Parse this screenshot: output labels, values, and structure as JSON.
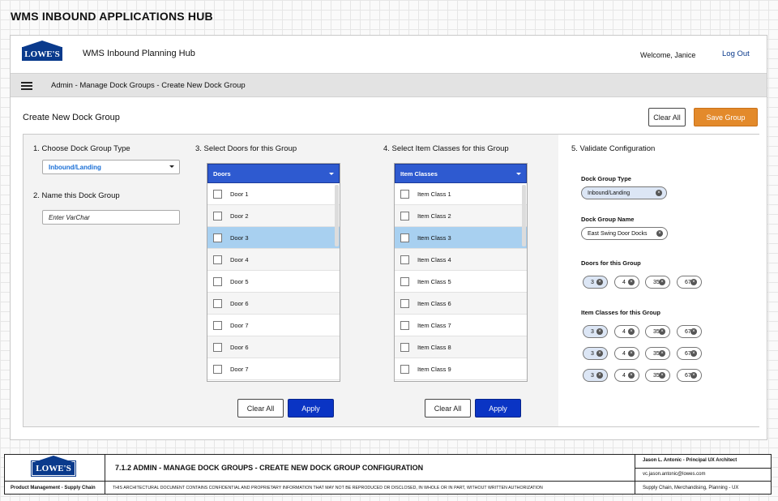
{
  "doc_title": "WMS INBOUND APPLICATIONS HUB",
  "header": {
    "logo_text": "LOWE'S",
    "app_name": "WMS Inbound Planning Hub",
    "welcome": "Welcome, Janice",
    "logout": "Log Out"
  },
  "breadcrumb": "Admin - Manage Dock Groups - Create New Dock Group",
  "page": {
    "title": "Create New Dock Group",
    "clear_all": "Clear All",
    "save_group": "Save Group"
  },
  "steps": {
    "s1": "1. Choose Dock Group Type",
    "s2": "2. Name this Dock Group",
    "s3": "3. Select Doors for this Group",
    "s4": "4. Select Item Classes for this Group",
    "s5": "5. Validate Configuration"
  },
  "dock_type_select": {
    "value": "Inbound/Landing"
  },
  "name_input": {
    "placeholder": "Enter VarChar"
  },
  "doors": {
    "header": "Doors",
    "items": [
      "Door 1",
      "Door 2",
      "Door 3",
      "Door 4",
      "Door 5",
      "Door 6",
      "Door 7",
      "Door 6",
      "Door 7"
    ],
    "selected_index": 2,
    "clear_label": "Clear All",
    "apply_label": "Apply"
  },
  "item_classes": {
    "header": "Item Classes",
    "items": [
      "Item Class 1",
      "Item Class 2",
      "Item Class 3",
      "Item Class 4",
      "Item Class 5",
      "Item Class 6",
      "Item Class 7",
      "Item Class 8",
      "Item Class 9"
    ],
    "selected_index": 2,
    "clear_label": "Clear All",
    "apply_label": "Apply"
  },
  "validate": {
    "dock_type_label": "Dock Group Type",
    "dock_type_value": "Inbound/Landing",
    "dock_name_label": "Dock Group Name",
    "dock_name_value": "East Swing Door Docks",
    "doors_label": "Doors for this Group",
    "doors_chips": [
      "3",
      "4",
      "35",
      "67"
    ],
    "classes_label": "Item Classes for this Group",
    "class_rows": [
      [
        "3",
        "4",
        "35",
        "67"
      ],
      [
        "3",
        "4",
        "35",
        "67"
      ],
      [
        "3",
        "4",
        "35",
        "67"
      ]
    ]
  },
  "footer": {
    "logo_text": "LOWE'S",
    "dept": "Product Management - Supply Chain",
    "section": "7.1.2  ADMIN - MANAGE DOCK GROUPS - CREATE NEW DOCK GROUP CONFIGURATION",
    "notice": "THIS ARCHITECTURAL DOCUMENT CONTAINS CONFIDENTIAL AND PROPRIETARY INFORMATION THAT MAY NOT BE REPRODUCED OR DISCLOSED, IN WHOLE OR IN PART, WITHOUT WRITTEN AUTHORIZATION",
    "author": "Jason L. Antonic - Principal UX Architect",
    "email": "vc.jason.antonic@lowes.com",
    "scope": "Supply Chain, Merchandising, Planning - UX"
  },
  "colors": {
    "brand": "#0a3a8c",
    "save": "#e38a2b",
    "apply": "#0a34c4",
    "list_header": "#2e5ad0",
    "selected_row": "#a8d0f0"
  }
}
